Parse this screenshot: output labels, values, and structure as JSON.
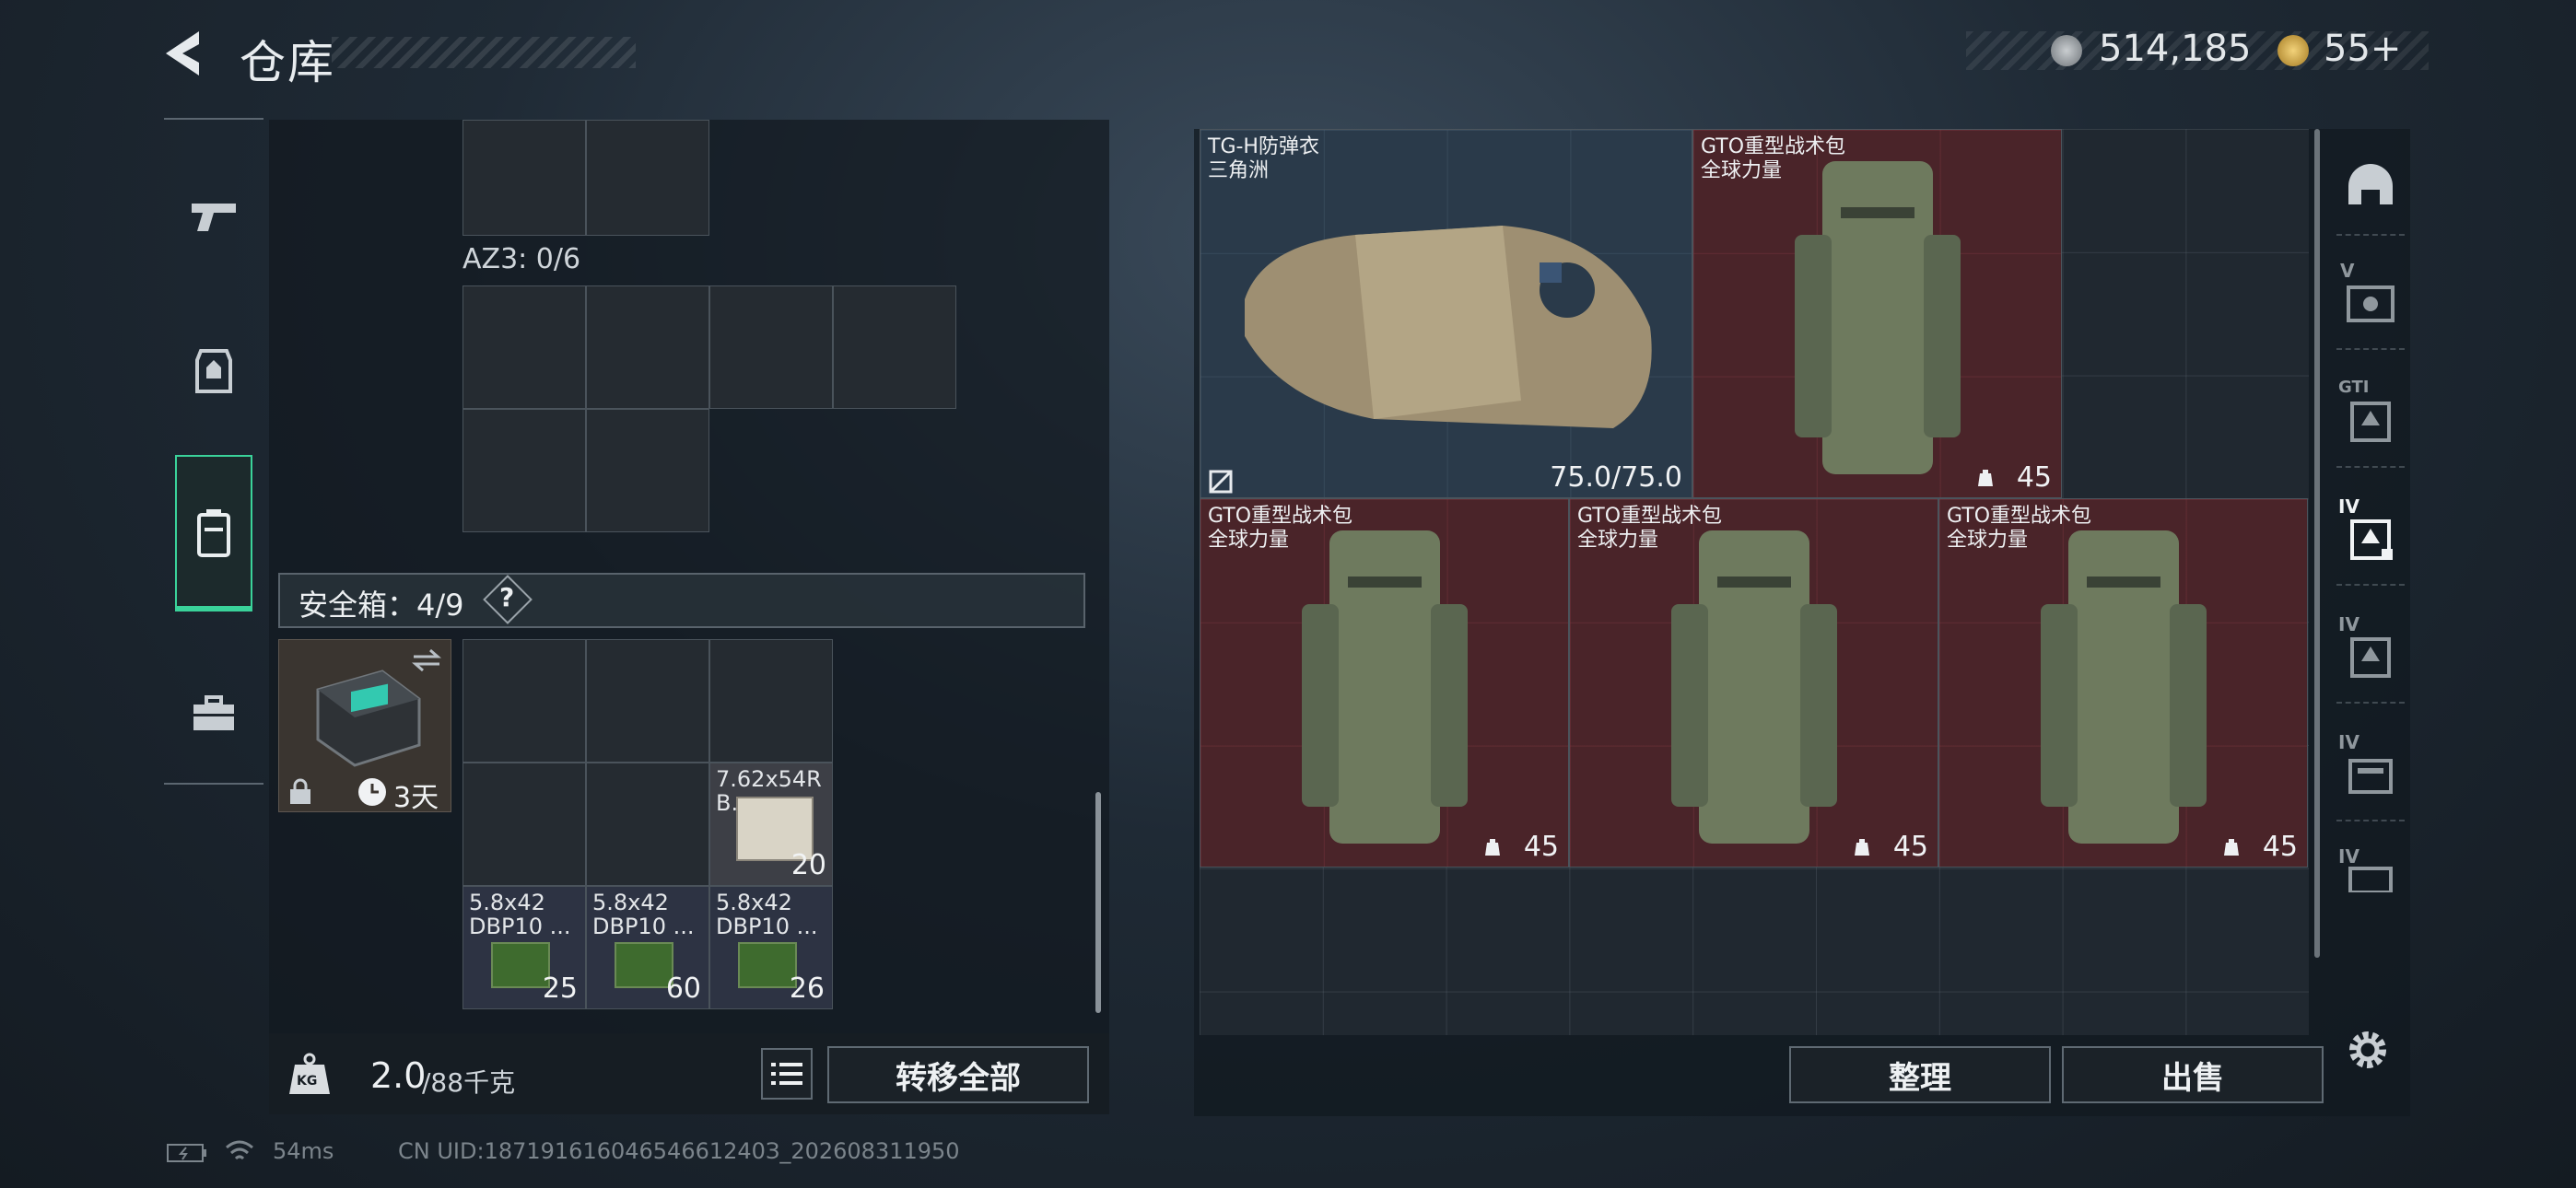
{
  "header": {
    "title": "仓库",
    "currency_primary": "514,185",
    "currency_secondary": "55+",
    "colors": {
      "accent_green": "#3ad29a",
      "item_red": "#4a2429",
      "item_blue": "#2a3a4a"
    }
  },
  "left_nav": {
    "items": [
      {
        "name": "pistol-icon"
      },
      {
        "name": "armor-icon"
      },
      {
        "name": "backpack-icon",
        "active": true
      },
      {
        "name": "toolbox-icon"
      }
    ]
  },
  "left_panel": {
    "az3_label": "AZ3: 0/6",
    "safe_box_label": "安全箱：4/9",
    "safe_box_help": "?",
    "safe_box_timer": "3天",
    "ammo_762": {
      "name_line1": "7.62x54R",
      "name_line2": "B...",
      "count": "20"
    },
    "ammo_58": [
      {
        "line1": "5.8x42",
        "line2": "DBP10 ...",
        "count": "25"
      },
      {
        "line1": "5.8x42",
        "line2": "DBP10 ...",
        "count": "60"
      },
      {
        "line1": "5.8x42",
        "line2": "DBP10 ...",
        "count": "26"
      }
    ],
    "weight_current": "2.0",
    "weight_max": "/88千克",
    "weight_icon_text": "KG",
    "transfer_all": "转移全部"
  },
  "stash": {
    "armor": {
      "line1": "TG-H防弹衣",
      "line2": "三角洲",
      "durability": "75.0/75.0"
    },
    "backpacks": [
      {
        "line1": "GTO重型战术包",
        "line2": "全球力量",
        "count": "45"
      },
      {
        "line1": "GTO重型战术包",
        "line2": "全球力量",
        "count": "45"
      },
      {
        "line1": "GTO重型战术包",
        "line2": "全球力量",
        "count": "45"
      },
      {
        "line1": "GTO重型战术包",
        "line2": "全球力量",
        "count": "45"
      }
    ],
    "organize": "整理",
    "sell": "出售"
  },
  "right_nav": {
    "items": [
      {
        "name": "helmet-icon",
        "label": ""
      },
      {
        "name": "weapon-case-icon",
        "label": "V"
      },
      {
        "name": "armor-tier-icon",
        "label": "GTI"
      },
      {
        "name": "backpack-tier-icon",
        "label": "IV"
      },
      {
        "name": "vest-tier-icon",
        "label": "IV"
      },
      {
        "name": "chest-rig-icon",
        "label": "IV"
      },
      {
        "name": "case-icon",
        "label": "IV"
      }
    ],
    "settings_icon": "gear-icon"
  },
  "footer": {
    "ping": "54ms",
    "uid": "CN UID:18719161604654661240З_202608311950"
  }
}
